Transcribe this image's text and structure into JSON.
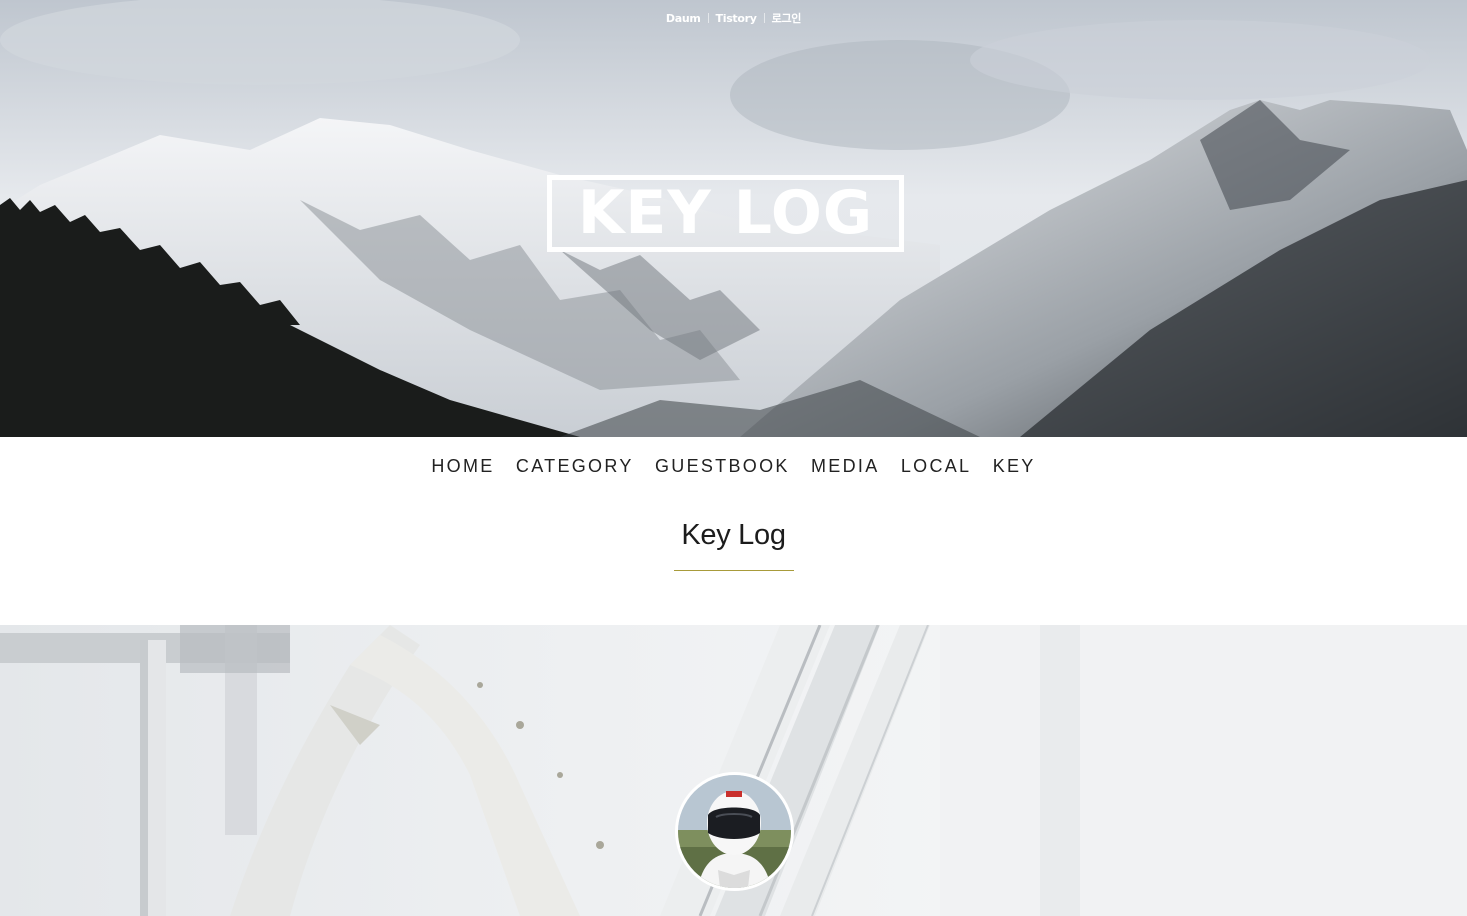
{
  "top_links": [
    {
      "label": "Daum"
    },
    {
      "label": "Tistory"
    },
    {
      "label": "로그인"
    }
  ],
  "logo": {
    "text": "KEY LOG"
  },
  "nav": {
    "items": [
      "HOME",
      "CATEGORY",
      "GUESTBOOK",
      "MEDIA",
      "LOCAL",
      "KEY"
    ]
  },
  "blog": {
    "title": "Key Log"
  },
  "colors": {
    "title_underline": "#a89b3a",
    "text": "#222222",
    "logo": "#ffffff"
  },
  "images": {
    "hero": "snowy-mountain-landscape",
    "profile_background": "white-bicycle-frame",
    "avatar": "white-helmet-driver"
  }
}
